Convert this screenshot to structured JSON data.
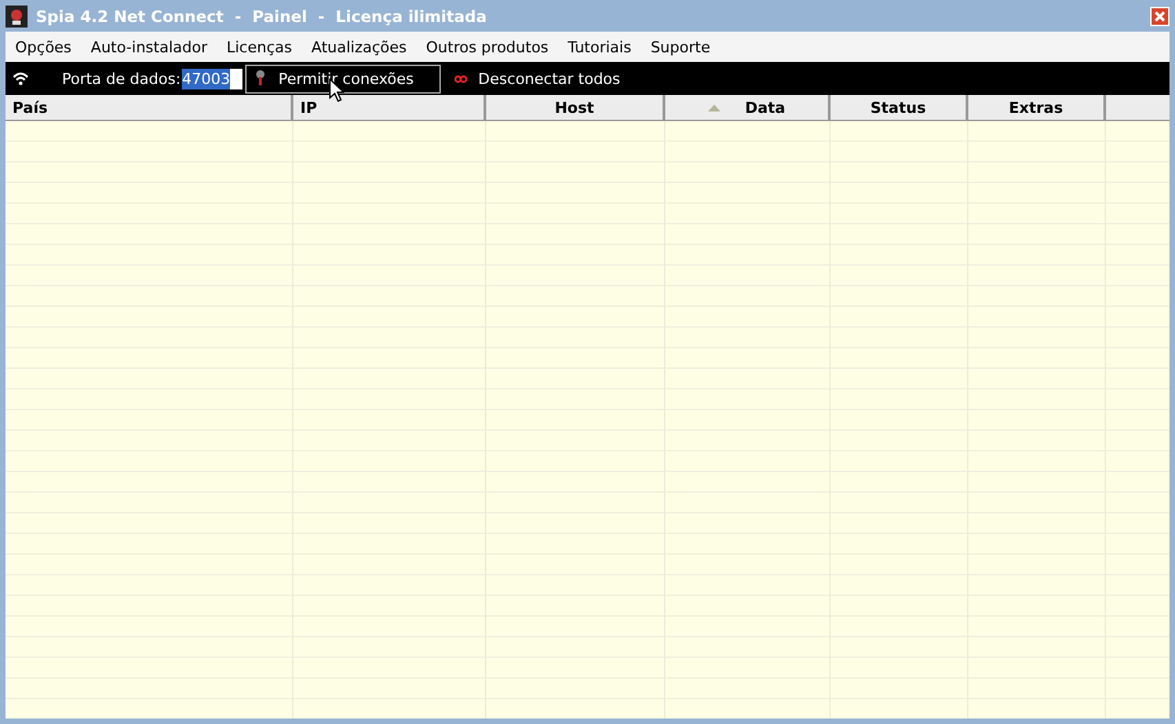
{
  "window": {
    "title": "Spia 4.2 Net Connect  -  Painel  -  Licença ilimitada"
  },
  "menu": [
    "Opções",
    "Auto-instalador",
    "Licenças",
    "Atualizações",
    "Outros produtos",
    "Tutoriais",
    "Suporte"
  ],
  "toolbar": {
    "port_label": "Porta de dados:",
    "port_value": "47003",
    "allow_button": "Permitir conexões",
    "disconnect_button": "Desconectar todos"
  },
  "table": {
    "columns": [
      {
        "label": "País",
        "sorted": false
      },
      {
        "label": "IP",
        "sorted": false
      },
      {
        "label": "Host",
        "sorted": false
      },
      {
        "label": "Data",
        "sorted": true
      },
      {
        "label": "Status",
        "sorted": false
      },
      {
        "label": "Extras",
        "sorted": false
      }
    ]
  }
}
